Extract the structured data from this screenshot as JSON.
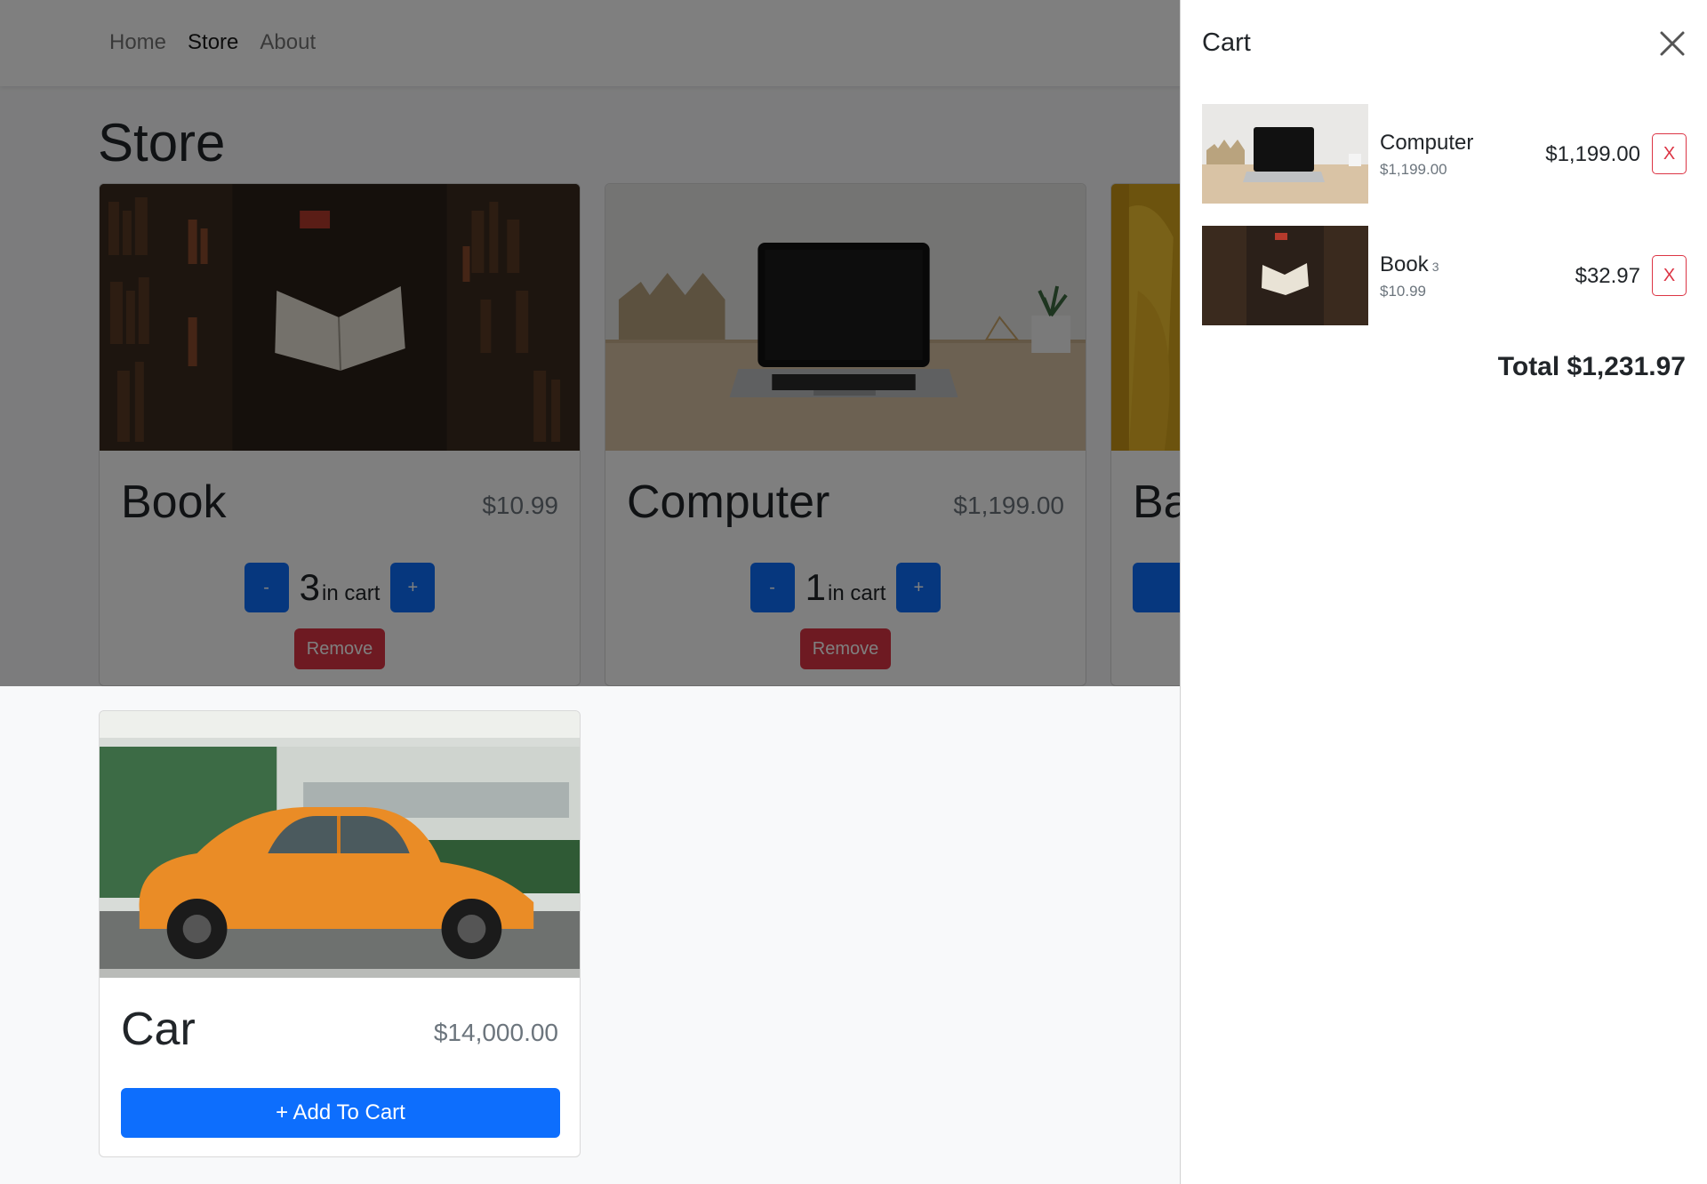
{
  "navbar": {
    "links": [
      {
        "label": "Home",
        "active": false
      },
      {
        "label": "Store",
        "active": true
      },
      {
        "label": "About",
        "active": false
      }
    ]
  },
  "page": {
    "title": "Store"
  },
  "products": [
    {
      "name": "Book",
      "price": "$10.99",
      "quantity": "3",
      "in_cart_label": "in cart",
      "minus_label": "-",
      "plus_label": "+",
      "remove_label": "Remove"
    },
    {
      "name": "Computer",
      "price": "$1,199.00",
      "quantity": "1",
      "in_cart_label": "in cart",
      "minus_label": "-",
      "plus_label": "+",
      "remove_label": "Remove"
    },
    {
      "name": "Ba"
    },
    {
      "name": "Car",
      "price": "$14,000.00",
      "add_label": "+ Add To Cart"
    }
  ],
  "cart": {
    "title": "Cart",
    "items": [
      {
        "name": "Computer",
        "quantity": "",
        "unit_price": "$1,199.00",
        "line_total": "$1,199.00",
        "remove_label": "X"
      },
      {
        "name": "Book",
        "quantity": "3",
        "unit_price": "$10.99",
        "line_total": "$32.97",
        "remove_label": "X"
      }
    ],
    "total": "Total $1,231.97"
  },
  "colors": {
    "primary": "#0d6efd",
    "danger": "#dc3545",
    "muted": "#6c757d",
    "background": "#f8f9fa"
  }
}
